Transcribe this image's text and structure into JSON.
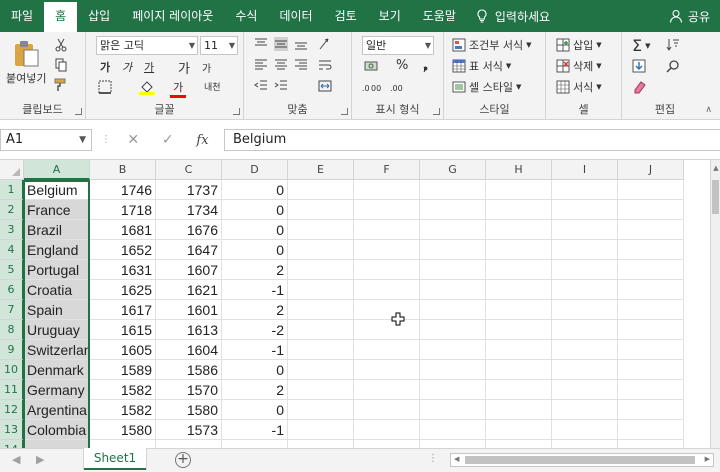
{
  "ribbon_tabs": [
    "파일",
    "홈",
    "삽입",
    "페이지 레이아웃",
    "수식",
    "데이터",
    "검토",
    "보기",
    "도움말"
  ],
  "active_tab": "홈",
  "tell_me": "입력하세요",
  "share": "공유",
  "clipboard": {
    "paste": "붙여넣기",
    "label": "클립보드"
  },
  "font": {
    "name": "맑은 고딕",
    "size": "11",
    "bold": "가",
    "italic": "가",
    "underline": "가",
    "grow": "가",
    "shrink": "가",
    "phonetic": "내천",
    "label": "글꼴"
  },
  "alignment": {
    "label": "맞춤"
  },
  "number": {
    "format": "일반",
    "percent": "%",
    "label": "표시 형식"
  },
  "styles": {
    "conditional": "조건부 서식",
    "table": "표 서식",
    "cell": "셀 스타일",
    "label": "스타일"
  },
  "cells": {
    "insert": "삽입",
    "delete": "삭제",
    "format": "서식",
    "label": "셀"
  },
  "editing": {
    "label": "편집"
  },
  "name_box": "A1",
  "formula_value": "Belgium",
  "columns": [
    "A",
    "B",
    "C",
    "D",
    "E",
    "F",
    "G",
    "H",
    "I",
    "J"
  ],
  "rows": [
    {
      "num": "1",
      "a": "Belgium",
      "b": "1746",
      "c": "1737",
      "d": "0"
    },
    {
      "num": "2",
      "a": "France",
      "b": "1718",
      "c": "1734",
      "d": "0"
    },
    {
      "num": "3",
      "a": "Brazil",
      "b": "1681",
      "c": "1676",
      "d": "0"
    },
    {
      "num": "4",
      "a": "England",
      "b": "1652",
      "c": "1647",
      "d": "0"
    },
    {
      "num": "5",
      "a": "Portugal",
      "b": "1631",
      "c": "1607",
      "d": "2"
    },
    {
      "num": "6",
      "a": "Croatia",
      "b": "1625",
      "c": "1621",
      "d": "-1"
    },
    {
      "num": "7",
      "a": "Spain",
      "b": "1617",
      "c": "1601",
      "d": "2"
    },
    {
      "num": "8",
      "a": "Uruguay",
      "b": "1615",
      "c": "1613",
      "d": "-2"
    },
    {
      "num": "9",
      "a": "Switzerland",
      "b": "1605",
      "c": "1604",
      "d": "-1"
    },
    {
      "num": "10",
      "a": "Denmark",
      "b": "1589",
      "c": "1586",
      "d": "0"
    },
    {
      "num": "11",
      "a": "Germany",
      "b": "1582",
      "c": "1570",
      "d": "2"
    },
    {
      "num": "12",
      "a": "Argentina",
      "b": "1582",
      "c": "1580",
      "d": "0"
    },
    {
      "num": "13",
      "a": "Colombia",
      "b": "1580",
      "c": "1573",
      "d": "-1"
    },
    {
      "num": "14",
      "a": "",
      "b": "",
      "c": "",
      "d": ""
    }
  ],
  "sheet_tab": "Sheet1",
  "colors": {
    "accent": "#217346",
    "selected_column": "#d8d8d8"
  }
}
